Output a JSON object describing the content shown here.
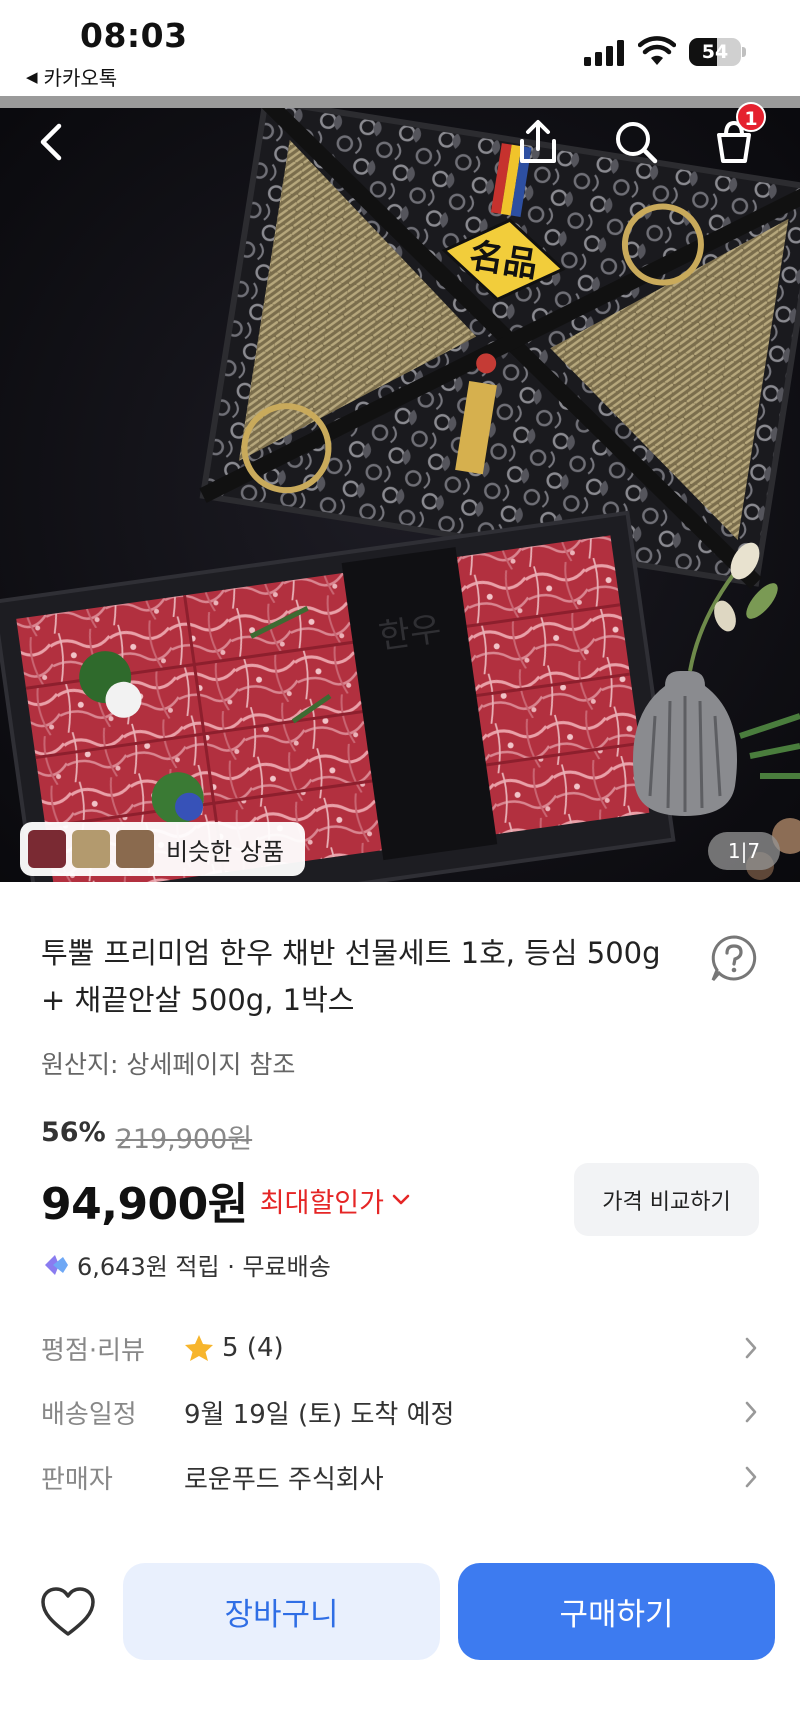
{
  "status_bar": {
    "time": "08:03",
    "back_app": "카카오톡",
    "battery_percent": "54",
    "battery_level": 0.54
  },
  "header": {
    "icons": [
      "back-arrow-icon",
      "share-icon",
      "search-icon",
      "cart-icon"
    ],
    "cart_badge": "1"
  },
  "gallery": {
    "similar_label": "비슷한 상품",
    "counter_current": "1",
    "counter_separator": "|",
    "counter_total": "7",
    "box_text": "名品",
    "tray_text": "한우"
  },
  "product": {
    "title": "투뿔 프리미엄 한우 채반 선물세트 1호, 등심 500g + 채끝안살 500g, 1박스",
    "origin": "원산지: 상세페이지 참조",
    "discount_percent": "56%",
    "original_price": "219,900원",
    "price": "94,900원",
    "max_discount_label": "최대할인가",
    "compare_button": "가격 비교하기",
    "points_text": "6,643원 적립 · 무료배송"
  },
  "info_rows": {
    "rating_label": "평점·리뷰",
    "rating_value": "5 (4)",
    "delivery_label": "배송일정",
    "delivery_value": "9월 19일 (토) 도착 예정",
    "seller_label": "판매자",
    "seller_value": "로운푸드 주식회사"
  },
  "bottom_bar": {
    "cart_button": "장바구니",
    "buy_button": "구매하기"
  },
  "colors": {
    "accent_blue": "#3d7bf0",
    "cart_button_bg": "#e9f0fd",
    "discount_red": "#e52626",
    "badge_red": "#e5212e",
    "star_yellow": "#f7b52c"
  }
}
